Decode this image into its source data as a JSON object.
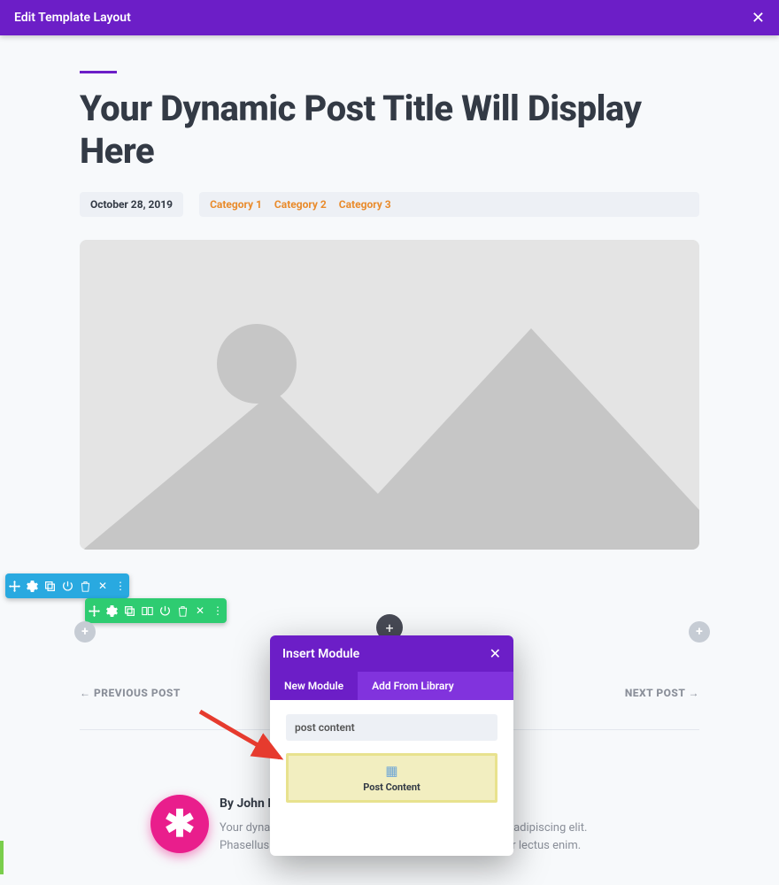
{
  "topbar": {
    "title": "Edit Template Layout"
  },
  "post": {
    "title": "Your Dynamic Post Title Will Display Here",
    "date": "October 28, 2019",
    "categories": [
      "Category 1",
      "Category 2",
      "Category 3"
    ]
  },
  "nav": {
    "prev": "← PREVIOUS POST",
    "next": "NEXT POST →"
  },
  "author": {
    "byline": "By John Doe",
    "desc_left": "Your dynamic",
    "desc_right": "ectetur adipiscing elit.",
    "desc2_left": "Phasellus auc",
    "desc2_right": "urabitur lectus enim."
  },
  "modal": {
    "title": "Insert Module",
    "tabs": {
      "new": "New Module",
      "library": "Add From Library"
    },
    "search_value": "post content",
    "result": {
      "label": "Post Content"
    }
  },
  "colors": {
    "accent": "#6c1ec7",
    "category": "#e98b2c"
  }
}
